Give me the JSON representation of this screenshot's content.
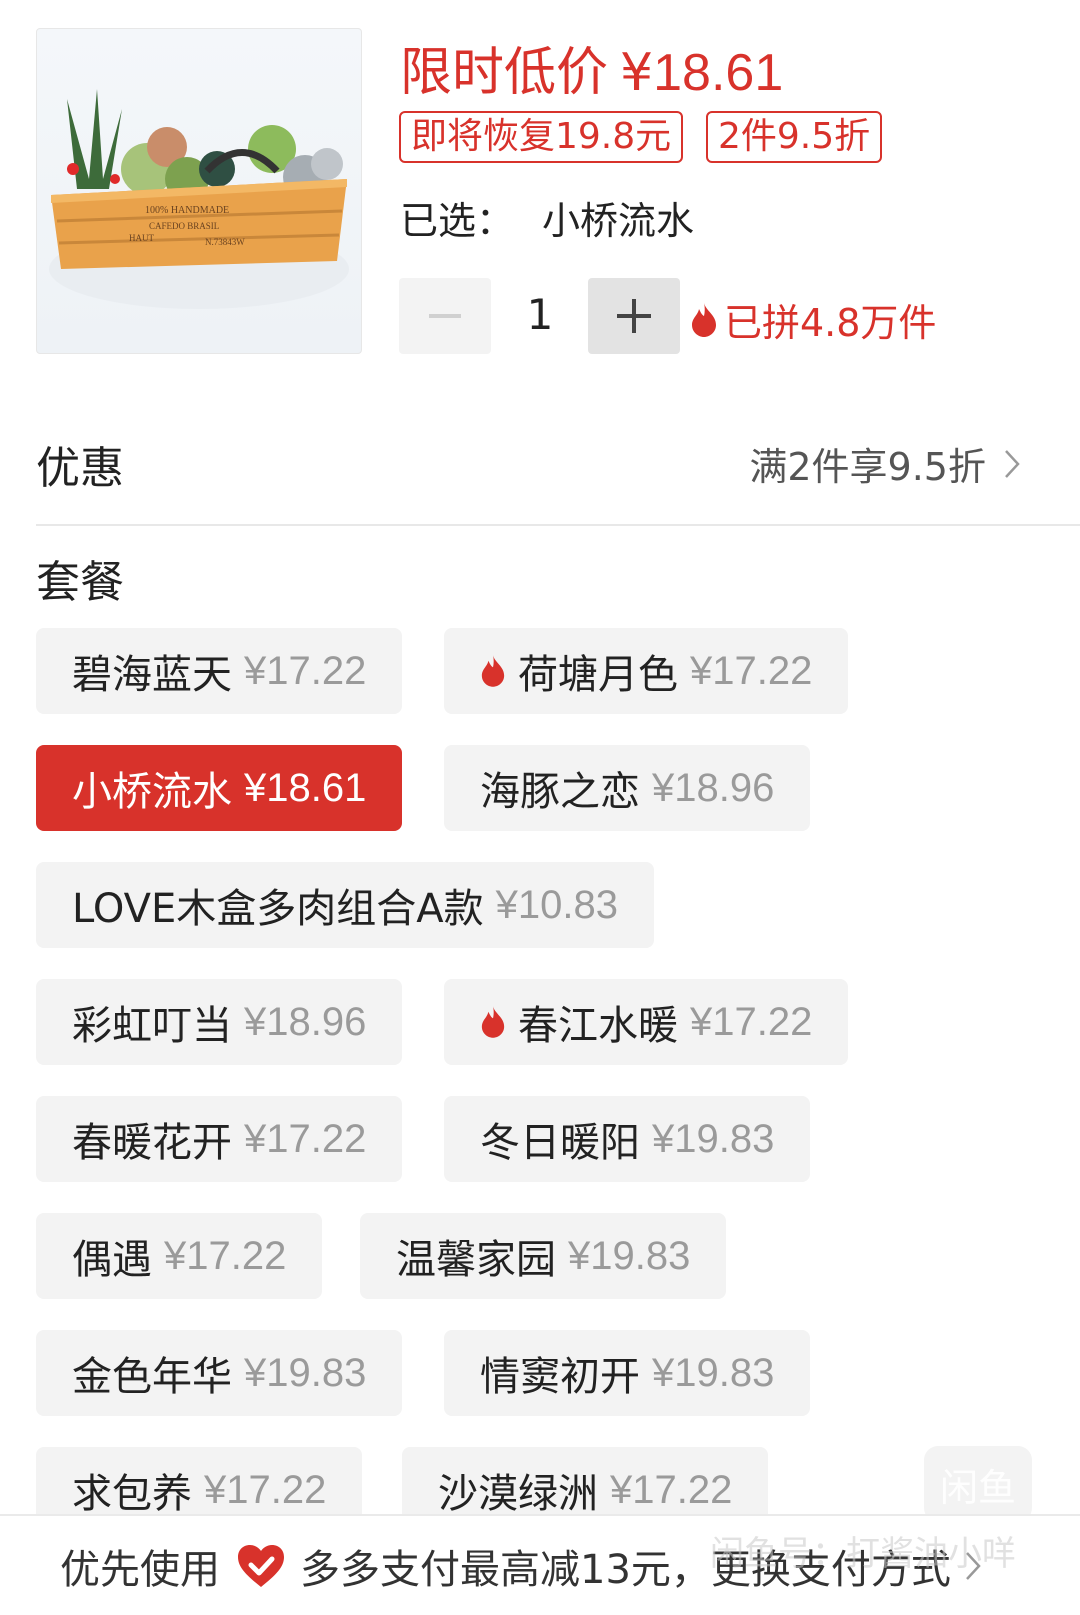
{
  "product": {
    "image_alt": "succulent wooden planter box",
    "box_print": [
      "100% HANDMADE",
      "CAFEDO BRASIL",
      "HAUT",
      "N.73843W"
    ]
  },
  "price": {
    "label": "限时低价",
    "currency": "¥",
    "amount": "18.61",
    "restore_tag": "即将恢复19.8元",
    "discount_tag": "2件9.5折"
  },
  "selection": {
    "label": "已选：",
    "value": "小桥流水"
  },
  "quantity": {
    "minus": "−",
    "value": "1",
    "plus": "+",
    "sold_text": "已拼4.8万件"
  },
  "discount": {
    "title": "优惠",
    "value": "满2件享9.5折"
  },
  "package": {
    "title": "套餐",
    "options": [
      {
        "name": "碧海蓝天",
        "price": "¥17.22"
      },
      {
        "name": "荷塘月色",
        "price": "¥17.22",
        "hot": true
      },
      {
        "name": "小桥流水",
        "price": "¥18.61",
        "selected": true
      },
      {
        "name": "海豚之恋",
        "price": "¥18.96"
      },
      {
        "name": "LOVE木盒多肉组合A款",
        "price": "¥10.83"
      },
      {
        "name": "彩虹叮当",
        "price": "¥18.96"
      },
      {
        "name": "春江水暖",
        "price": "¥17.22",
        "hot": true
      },
      {
        "name": "春暖花开",
        "price": "¥17.22"
      },
      {
        "name": "冬日暖阳",
        "price": "¥19.83"
      },
      {
        "name": "偶遇",
        "price": "¥17.22"
      },
      {
        "name": "温馨家园",
        "price": "¥19.83"
      },
      {
        "name": "金色年华",
        "price": "¥19.83"
      },
      {
        "name": "情窦初开",
        "price": "¥19.83"
      },
      {
        "name": "求包养",
        "price": "¥17.22"
      },
      {
        "name": "沙漠绿洲",
        "price": "¥17.22"
      }
    ]
  },
  "bottom": {
    "prefix": "优先使用",
    "text": "多多支付最高减13元，更换支付方式"
  },
  "watermark": {
    "badge": "闲鱼",
    "text": "闲鱼号：打酱油小咩"
  },
  "colors": {
    "accent": "#d8322b",
    "muted": "#9a9a9a"
  }
}
